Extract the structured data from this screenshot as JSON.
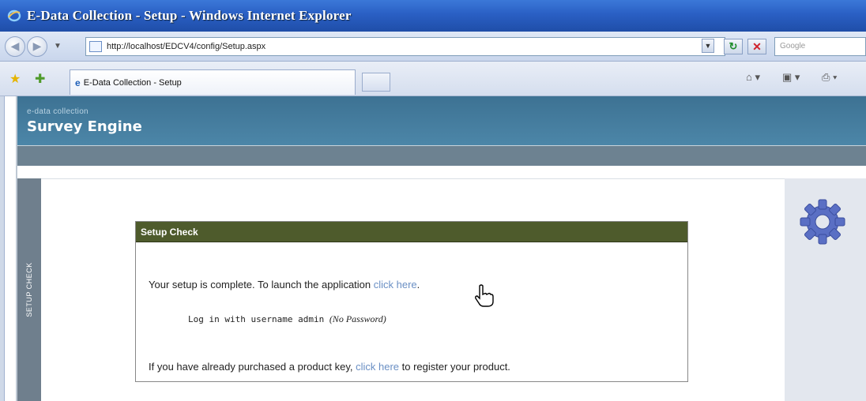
{
  "window": {
    "title": "E-Data Collection - Setup - Windows Internet Explorer"
  },
  "address_bar": {
    "url": "http://localhost/EDCV4/config/Setup.aspx",
    "search_placeholder": "Google"
  },
  "tabs": [
    {
      "label": "E-Data Collection - Setup"
    }
  ],
  "header": {
    "brand_small": "e-data collection",
    "brand_big": "Survey Engine"
  },
  "sidebar": {
    "label": "SETUP CHECK"
  },
  "setup_box": {
    "title": "Setup Check",
    "line1_prefix": "Your setup is complete. To launch the application ",
    "line1_link": "click here",
    "line1_suffix": ".",
    "login_prefix": "Log in with username admin ",
    "login_note": "(No Password)",
    "line3_prefix": "If you have already purchased a product key, ",
    "line3_link": "click here",
    "line3_suffix": " to register your product."
  },
  "colors": {
    "header_band": "#4477a0",
    "box_title_bg": "#4e5b2c",
    "link": "#6a8fc4"
  }
}
